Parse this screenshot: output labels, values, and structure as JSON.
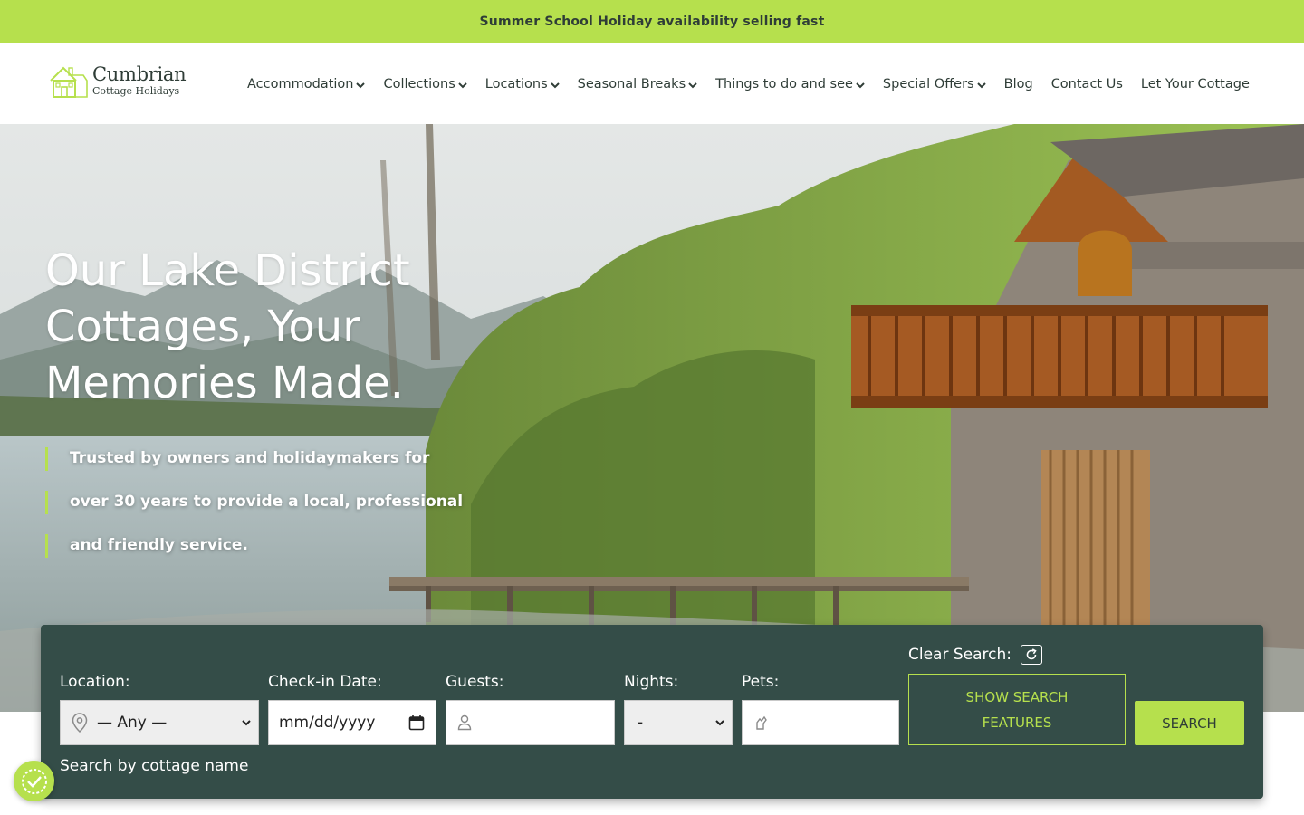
{
  "announcement": {
    "text": "Summer School Holiday availability selling fast"
  },
  "logo": {
    "main": "Cumbrian",
    "sub": "Cottage Holidays"
  },
  "nav": {
    "items": [
      {
        "label": "Accommodation",
        "dropdown": true
      },
      {
        "label": "Collections",
        "dropdown": true
      },
      {
        "label": "Locations",
        "dropdown": true
      },
      {
        "label": "Seasonal Breaks",
        "dropdown": true
      },
      {
        "label": "Things to do and see",
        "dropdown": true
      },
      {
        "label": "Special Offers",
        "dropdown": true
      },
      {
        "label": "Blog",
        "dropdown": false
      },
      {
        "label": "Contact Us",
        "dropdown": false
      },
      {
        "label": "Let Your Cottage",
        "dropdown": false
      }
    ]
  },
  "hero": {
    "title": "Our Lake District Cottages, Your Memories Made.",
    "subtitle_lines": [
      "Trusted by owners and holidaymakers for",
      "over 30 years to provide a local, professional",
      "and friendly service."
    ]
  },
  "search": {
    "location_label": "Location:",
    "location_value": "— Any —",
    "checkin_label": "Check-in Date:",
    "checkin_placeholder": "mm/dd/yyyy",
    "guests_label": "Guests:",
    "guests_value": "",
    "nights_label": "Nights:",
    "nights_value": "-",
    "pets_label": "Pets:",
    "pets_value": "",
    "clear_label": "Clear Search:",
    "show_features_label": "SHOW SEARCH FEATURES",
    "search_button_label": "SEARCH",
    "by_name_label": "Search by cottage name"
  },
  "icons": {
    "location": "map-pin-icon",
    "calendar": "calendar-icon",
    "guests": "person-icon",
    "pets": "paw-icon",
    "clear": "refresh-icon",
    "cookie": "cookie-consent-icon"
  },
  "colors": {
    "accent": "#b6e04d",
    "panel": "#344d48",
    "text_dark": "#2f3d37"
  }
}
